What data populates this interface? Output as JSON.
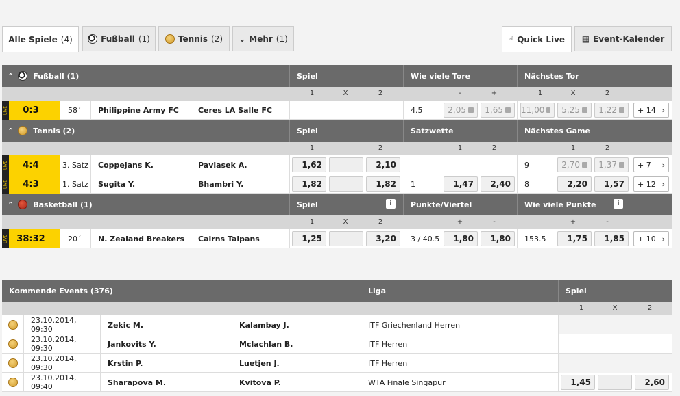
{
  "tabs": [
    {
      "label": "Alle Spiele",
      "count": "(4)"
    },
    {
      "label": "Fußball",
      "count": "(1)"
    },
    {
      "label": "Tennis",
      "count": "(2)"
    },
    {
      "label": "Mehr",
      "count": "(1)"
    }
  ],
  "right_tabs": {
    "quick_live": "Quick Live",
    "calendar": "Event-Kalender"
  },
  "live_badge": "LIVE",
  "sections": {
    "football": {
      "title": "Fußball (1)",
      "col_spiel": "Spiel",
      "col_2": "Wie viele Tore",
      "col_3": "Nächstes Tor",
      "sub": {
        "s1": "1",
        "sx": "X",
        "s2": "2",
        "minus": "-",
        "plus": "+",
        "n1": "1",
        "nx": "X",
        "n2": "2"
      },
      "row": {
        "score": "0:3",
        "time": "58´",
        "home": "Philippine Army FC",
        "away": "Ceres LA Salle FC",
        "line": "4.5",
        "o1": "2,05",
        "o2": "1,65",
        "o3": "11,00",
        "o4": "5,25",
        "o5": "1,22",
        "more": "+ 14"
      }
    },
    "tennis": {
      "title": "Tennis (2)",
      "col_spiel": "Spiel",
      "col_2": "Satzwette",
      "col_3": "Nächstes Game",
      "sub": {
        "s1": "1",
        "s2": "2",
        "z1": "1",
        "z2": "2",
        "n1": "1",
        "n2": "2"
      },
      "rows": [
        {
          "score": "4:4",
          "time": "3. Satz",
          "home": "Coppejans K.",
          "away": "Pavlasek A.",
          "o1": "1,62",
          "o2": "2,10",
          "sl": "",
          "so1": "",
          "so2": "",
          "nl": "9",
          "no1": "2,70",
          "no2": "1,37",
          "more": "+ 7"
        },
        {
          "score": "4:3",
          "time": "1. Satz",
          "home": "Sugita Y.",
          "away": "Bhambri Y.",
          "o1": "1,82",
          "o2": "1,82",
          "sl": "1",
          "so1": "1,47",
          "so2": "2,40",
          "nl": "8",
          "no1": "2,20",
          "no2": "1,57",
          "more": "+ 12"
        }
      ]
    },
    "basketball": {
      "title": "Basketball (1)",
      "col_spiel": "Spiel",
      "col_2": "Punkte/Viertel",
      "col_3": "Wie viele Punkte",
      "info": "i",
      "sub": {
        "s1": "1",
        "sx": "X",
        "s2": "2",
        "plus": "+",
        "minus": "-",
        "plus2": "+",
        "minus2": "-"
      },
      "row": {
        "score": "38:32",
        "time": "20´",
        "home": "N. Zealand Breakers",
        "away": "Cairns Taipans",
        "o1": "1,25",
        "o2": "3,20",
        "pl": "3 / 40.5",
        "p1": "1,80",
        "p2": "1,80",
        "wl": "153.5",
        "w1": "1,75",
        "w2": "1,85",
        "more": "+ 10"
      }
    }
  },
  "upcoming": {
    "title": "Kommende Events (376)",
    "col_liga": "Liga",
    "col_spiel": "Spiel",
    "sub": {
      "s1": "1",
      "sx": "X",
      "s2": "2"
    },
    "rows": [
      {
        "date": "23.10.2014, 09:30",
        "home": "Zekic M.",
        "away": "Kalambay J.",
        "league": "ITF Griechenland Herren",
        "o1": "",
        "o2": ""
      },
      {
        "date": "23.10.2014, 09:30",
        "home": "Jankovits Y.",
        "away": "Mclachlan B.",
        "league": "ITF Herren",
        "o1": "",
        "o2": ""
      },
      {
        "date": "23.10.2014, 09:30",
        "home": "Krstin P.",
        "away": "Luetjen J.",
        "league": "ITF Herren",
        "o1": "",
        "o2": ""
      },
      {
        "date": "23.10.2014, 09:40",
        "home": "Sharapova M.",
        "away": "Kvitova P.",
        "league": "WTA Finale Singapur",
        "o1": "1,45",
        "o2": "2,60"
      }
    ]
  }
}
